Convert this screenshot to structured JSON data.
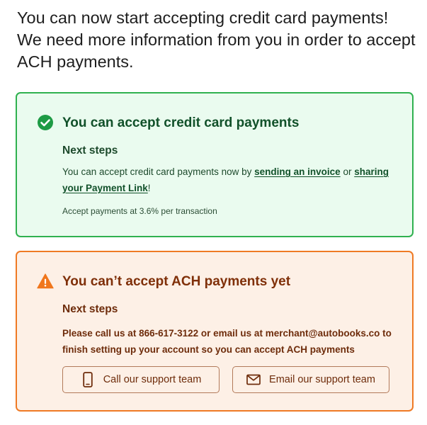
{
  "intro": {
    "line1": "You can now start accepting credit card payments!",
    "line2": "We need more information from you in order to accept ACH payments."
  },
  "credit_card_card": {
    "icon": "check-circle-icon",
    "title": "You can accept credit card payments",
    "steps_heading": "Next steps",
    "body_prefix": "You can accept credit card payments now by ",
    "link_invoice": "sending an invoice",
    "body_middle": " or ",
    "link_payment_link": "sharing your Payment Link",
    "body_suffix": "!",
    "fee_text": "Accept payments at 3.6% per transaction",
    "colors": {
      "border": "#2fb14f",
      "background": "#eafbef",
      "title": "#11512a"
    }
  },
  "ach_card": {
    "icon": "warning-triangle-icon",
    "title": "You can’t accept ACH payments yet",
    "steps_heading": "Next steps",
    "body_prefix": "Please call us at ",
    "phone": "866-617-3122",
    "body_middle": " or email us at ",
    "email": "merchant@autobooks.co",
    "body_suffix": " to finish setting up your account so you can accept ACH payments",
    "call_button_label": "Call our support team",
    "call_button_icon": "phone-icon",
    "email_button_label": "Email our support team",
    "email_button_icon": "envelope-icon",
    "colors": {
      "border": "#ef7a24",
      "background": "#fdf0e6",
      "title": "#7f2f08"
    }
  }
}
